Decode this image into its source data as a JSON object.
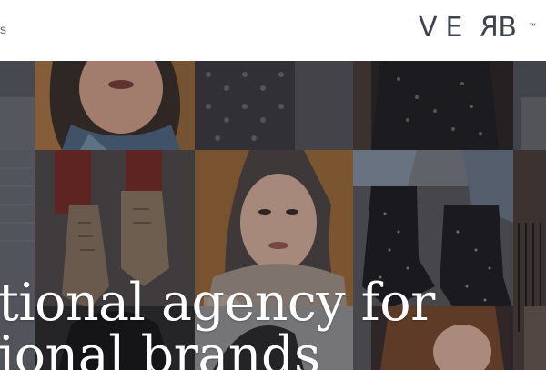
{
  "header": {
    "nav_fragment": "s",
    "logo": {
      "v": "V",
      "e": "E",
      "r": "R",
      "b": "B",
      "tm": "™"
    }
  },
  "hero": {
    "headline_line1": "tional agency for",
    "headline_line2": "ional brands"
  },
  "colors": {
    "logo": "#3f4350",
    "overlay": "#1e2026",
    "headline": "#ffffff"
  }
}
